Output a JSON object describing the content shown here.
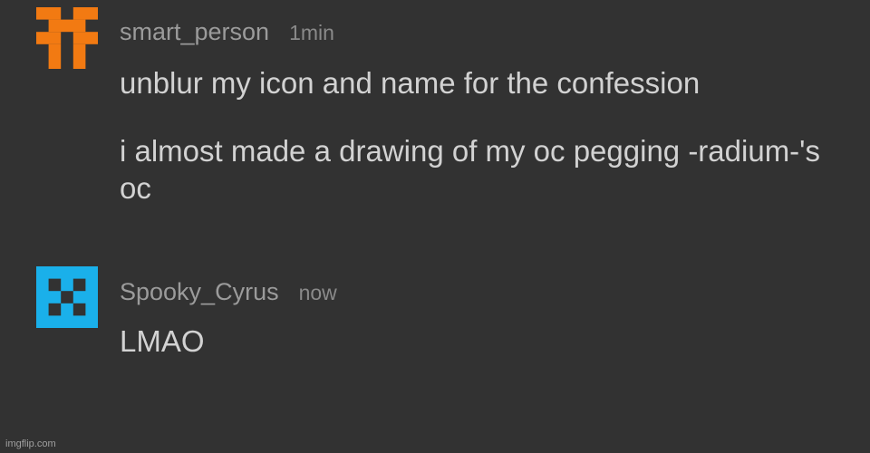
{
  "comments": [
    {
      "username": "smart_person",
      "time": "1min",
      "avatar_color": "#f27a12",
      "avatar_icon": "orange-pixel-identicon",
      "paragraphs": [
        "unblur my icon and name for the confession",
        "i almost made a drawing of my oc pegging -radium-'s oc"
      ]
    },
    {
      "username": "Spooky_Cyrus",
      "time": "now",
      "avatar_color": "#1ab0ea",
      "avatar_icon": "blue-pixel-identicon",
      "paragraphs": [
        "LMAO"
      ]
    }
  ],
  "watermark": "imgflip.com",
  "colors": {
    "background": "#323232",
    "username": "#9b9b9b",
    "message": "#d2d2d2"
  }
}
